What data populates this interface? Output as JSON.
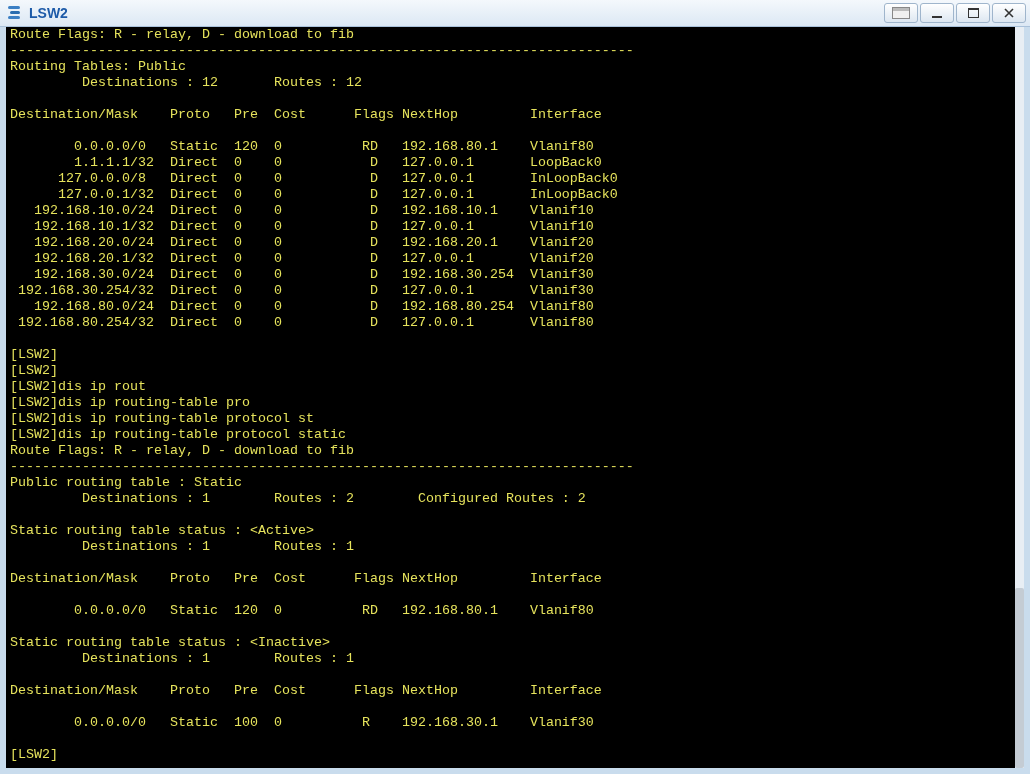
{
  "window": {
    "title": "LSW2"
  },
  "terminal": {
    "lines": [
      {
        "kind": "text",
        "text": "Route Flags: R - relay, D - download to fib"
      },
      {
        "kind": "text",
        "text": "------------------------------------------------------------------------------"
      },
      {
        "kind": "text",
        "text": "Routing Tables: Public"
      },
      {
        "kind": "text",
        "text": "         Destinations : 12       Routes : 12"
      },
      {
        "kind": "blank"
      },
      {
        "kind": "text",
        "text": "Destination/Mask    Proto   Pre  Cost      Flags NextHop         Interface"
      },
      {
        "kind": "blank"
      },
      {
        "kind": "text",
        "text": "        0.0.0.0/0   Static  120  0          RD   192.168.80.1    Vlanif80"
      },
      {
        "kind": "text",
        "text": "        1.1.1.1/32  Direct  0    0           D   127.0.0.1       LoopBack0"
      },
      {
        "kind": "text",
        "text": "      127.0.0.0/8   Direct  0    0           D   127.0.0.1       InLoopBack0"
      },
      {
        "kind": "text",
        "text": "      127.0.0.1/32  Direct  0    0           D   127.0.0.1       InLoopBack0"
      },
      {
        "kind": "text",
        "text": "   192.168.10.0/24  Direct  0    0           D   192.168.10.1    Vlanif10"
      },
      {
        "kind": "text",
        "text": "   192.168.10.1/32  Direct  0    0           D   127.0.0.1       Vlanif10"
      },
      {
        "kind": "text",
        "text": "   192.168.20.0/24  Direct  0    0           D   192.168.20.1    Vlanif20"
      },
      {
        "kind": "text",
        "text": "   192.168.20.1/32  Direct  0    0           D   127.0.0.1       Vlanif20"
      },
      {
        "kind": "text",
        "text": "   192.168.30.0/24  Direct  0    0           D   192.168.30.254  Vlanif30"
      },
      {
        "kind": "text",
        "text": " 192.168.30.254/32  Direct  0    0           D   127.0.0.1       Vlanif30"
      },
      {
        "kind": "text",
        "text": "   192.168.80.0/24  Direct  0    0           D   192.168.80.254  Vlanif80"
      },
      {
        "kind": "text",
        "text": " 192.168.80.254/32  Direct  0    0           D   127.0.0.1       Vlanif80"
      },
      {
        "kind": "blank"
      },
      {
        "kind": "text",
        "text": "[LSW2]"
      },
      {
        "kind": "text",
        "text": "[LSW2]"
      },
      {
        "kind": "text",
        "text": "[LSW2]dis ip rout"
      },
      {
        "kind": "text",
        "text": "[LSW2]dis ip routing-table pro"
      },
      {
        "kind": "text",
        "text": "[LSW2]dis ip routing-table protocol st"
      },
      {
        "kind": "text",
        "text": "[LSW2]dis ip routing-table protocol static"
      },
      {
        "kind": "text",
        "text": "Route Flags: R - relay, D - download to fib"
      },
      {
        "kind": "text",
        "text": "------------------------------------------------------------------------------"
      },
      {
        "kind": "text",
        "text": "Public routing table : Static"
      },
      {
        "kind": "text",
        "text": "         Destinations : 1        Routes : 2        Configured Routes : 2"
      },
      {
        "kind": "blank"
      },
      {
        "kind": "text",
        "text": "Static routing table status : <Active>"
      },
      {
        "kind": "text",
        "text": "         Destinations : 1        Routes : 1"
      },
      {
        "kind": "blank"
      },
      {
        "kind": "text",
        "text": "Destination/Mask    Proto   Pre  Cost      Flags NextHop         Interface"
      },
      {
        "kind": "blank"
      },
      {
        "kind": "text",
        "text": "        0.0.0.0/0   Static  120  0          RD   192.168.80.1    Vlanif80"
      },
      {
        "kind": "blank"
      },
      {
        "kind": "text",
        "text": "Static routing table status : <Inactive>"
      },
      {
        "kind": "text",
        "text": "         Destinations : 1        Routes : 1"
      },
      {
        "kind": "blank"
      },
      {
        "kind": "text",
        "text": "Destination/Mask    Proto   Pre  Cost      Flags NextHop         Interface"
      },
      {
        "kind": "blank"
      },
      {
        "kind": "text",
        "text": "        0.0.0.0/0   Static  100  0          R    192.168.30.1    Vlanif30"
      },
      {
        "kind": "blank"
      },
      {
        "kind": "text",
        "text": "[LSW2]"
      }
    ]
  }
}
